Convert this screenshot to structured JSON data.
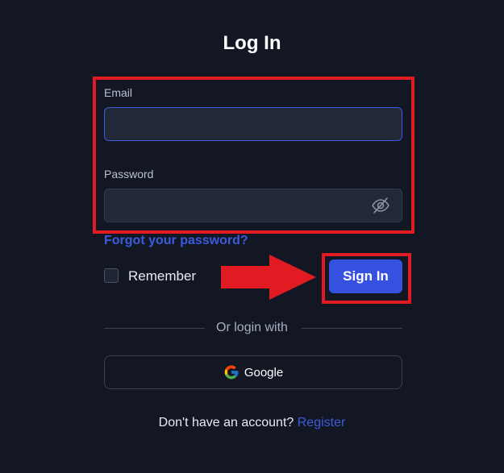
{
  "title": "Log In",
  "form": {
    "email_label": "Email",
    "email_value": "",
    "password_label": "Password",
    "password_value": "",
    "forgot_password": "Forgot your password?",
    "remember_label": "Remember",
    "remember_checked": false,
    "sign_in_label": "Sign In"
  },
  "alt_login": {
    "divider_text": "Or login with",
    "google_label": "Google"
  },
  "footer": {
    "prompt": "Don't have an account?",
    "register_link": "Register"
  },
  "icons": {
    "password_toggle": "eye-slash-icon",
    "google": "google-logo-icon",
    "annotation": "red-arrow-icon"
  },
  "colors": {
    "background": "#121723",
    "accent": "#3651e0",
    "link": "#3b5bdb",
    "annotation_red": "#e21b23",
    "input_bg": "#212838"
  }
}
